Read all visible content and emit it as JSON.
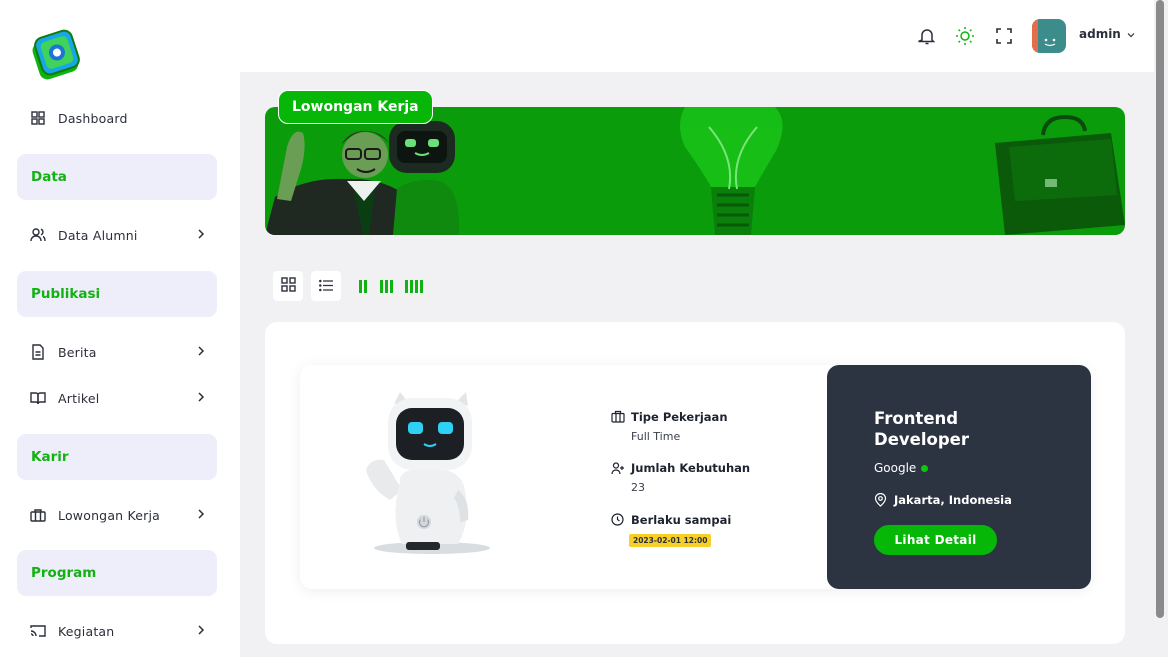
{
  "sidebar": {
    "items": [
      {
        "label": "Dashboard",
        "icon": "grid-icon"
      },
      {
        "label": "Data Alumni",
        "icon": "users-icon"
      },
      {
        "label": "Berita",
        "icon": "document-icon"
      },
      {
        "label": "Artikel",
        "icon": "book-icon"
      },
      {
        "label": "Lowongan Kerja",
        "icon": "briefcase-icon"
      },
      {
        "label": "Kegiatan",
        "icon": "cast-icon"
      }
    ],
    "sections": [
      "Data",
      "Publikasi",
      "Karir",
      "Program"
    ]
  },
  "header": {
    "user_name": "admin"
  },
  "banner": {
    "title": "Lowongan Kerja"
  },
  "colors": {
    "accent": "#07b707",
    "dark_panel": "#2c3341",
    "section_bg": "#eeeefb",
    "date_badge": "#f6cf27"
  },
  "job": {
    "type_label": "Tipe Pekerjaan",
    "type_value": "Full Time",
    "need_label": "Jumlah Kebutuhan",
    "need_value": "23",
    "until_label": "Berlaku sampai",
    "until_value": "2023-02-01 12:00",
    "title": "Frontend Developer",
    "company": "Google",
    "location": "Jakarta, Indonesia",
    "detail_button": "Lihat Detail"
  }
}
